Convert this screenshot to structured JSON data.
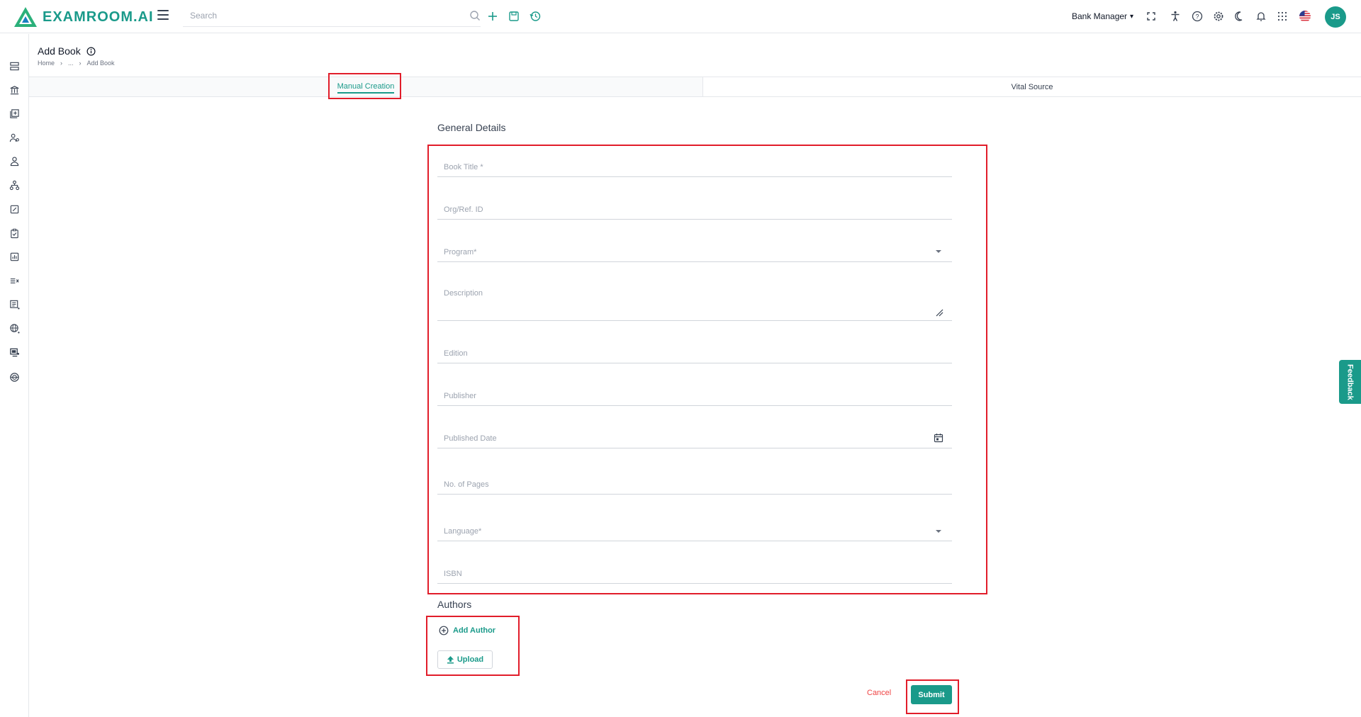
{
  "app": {
    "brand": "EXAMROOM.AI",
    "accent_color": "#1a9a8a"
  },
  "header": {
    "search_placeholder": "Search",
    "role": "Bank Manager",
    "avatar_initials": "JS",
    "icons": [
      "search-icon",
      "plus-icon",
      "save-icon",
      "history-icon",
      "fullscreen-icon",
      "accessibility-icon",
      "help-icon",
      "settings-icon",
      "dark-mode-icon",
      "notification-icon",
      "apps-grid-icon",
      "us-flag-icon"
    ]
  },
  "sidebar": {
    "icons": [
      "layers-icon",
      "bank-icon",
      "library-icon",
      "users-icon",
      "user-icon",
      "hierarchy-icon",
      "edit-doc-icon",
      "checklist-icon",
      "report-icon",
      "list-icon",
      "book-icon",
      "globe-icon",
      "monitor-icon",
      "web-icon"
    ]
  },
  "page": {
    "title": "Add Book",
    "breadcrumb": [
      "Home",
      "...",
      "Add Book"
    ]
  },
  "tabs": [
    {
      "label": "Manual Creation",
      "active": true
    },
    {
      "label": "Vital Source",
      "active": false
    }
  ],
  "form": {
    "section_title": "General Details",
    "fields": {
      "book_title": "Book Title *",
      "org_ref_id": "Org/Ref. ID",
      "program": "Program*",
      "description": "Description",
      "edition": "Edition",
      "publisher": "Publisher",
      "published_date": "Published Date",
      "pages": "No. of Pages",
      "language": "Language*",
      "isbn": "ISBN"
    }
  },
  "authors": {
    "title": "Authors",
    "add_label": "Add Author",
    "upload_label": "Upload"
  },
  "actions": {
    "cancel": "Cancel",
    "submit": "Submit"
  },
  "feedback": "Feedback"
}
